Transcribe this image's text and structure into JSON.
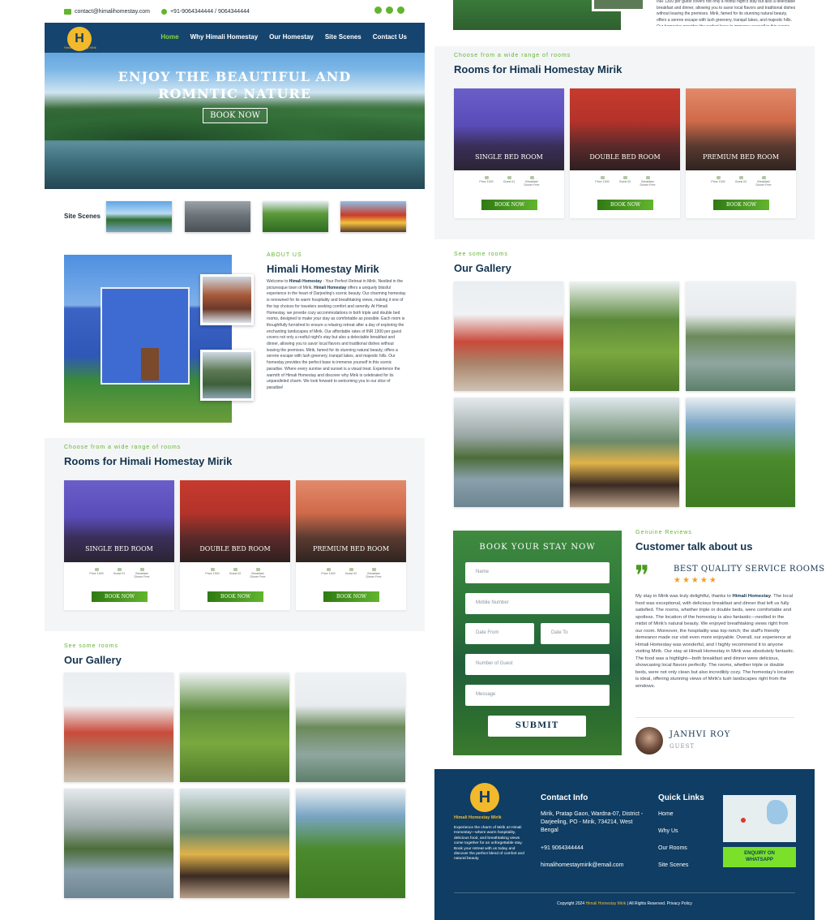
{
  "topbar": {
    "email": "contact@himalihomestay.com",
    "phone": "+91-9064344444 / 9064344444",
    "social_icons": [
      "whatsapp-icon",
      "instagram-icon",
      "facebook-icon"
    ]
  },
  "brand": {
    "logo_letter": "H",
    "name": "Himali Homestay Mirik"
  },
  "nav": {
    "items": [
      "Home",
      "Why Himali Homestay",
      "Our Homestay",
      "Site Scenes",
      "Contact Us"
    ],
    "active": "Home"
  },
  "hero": {
    "title_line1": "ENJOY THE BEAUTIFUL AND",
    "title_line2": "ROMNTIC NATURE",
    "button": "BOOK NOW"
  },
  "scenes": {
    "label": "Site Scenes"
  },
  "about": {
    "eyebrow": "ABOUT US",
    "title": "Himali Homestay Mirik",
    "intro": "Welcome to",
    "brand_bold": "Himali Homestay",
    "text_1": " - Your Perfect Retreat in Mirik. Nestled in the picturesque town of Mirik,",
    "brand_bold_2": "Himali Homestay",
    "text_2": " offers a uniquely blissful experience in the heart of Darjeeling's scenic beauty. Our charming homestay is renowned for its warm hospitality and breathtaking views, making it one of the top choices for travelers seeking comfort and serenity. At Himali Homestay, we provide cozy accommodations in both triple and double bed rooms, designed to make your stay as comfortable as possible. Each room is thoughtfully furnished to ensure a relaxing retreat after a day of exploring the enchanting landscapes of Mirik. Our affordable rates of INR 1300 per guest covers not only a restful night's stay but also a delectable breakfast and dinner, allowing you to savor local flavors and traditional dishes without leaving the premises. Mirik, famed for its stunning natural beauty, offers a serene escape with lush greenery, tranquil lakes, and majestic hills. Our homestay provides the perfect base to immerse yourself in this scenic paradise. Where every sunrise and sunset is a visual treat. Experience the warmth of Himali Homestay and discover why Mirik is celebrated for its unparalleled charm. We look forward to welcoming you to our slice of paradise!"
  },
  "rooms": {
    "eyebrow": "Choose from a wide range of rooms",
    "title": "Rooms for Himali Homestay Mirik",
    "items": [
      {
        "name": "SINGLE BED ROOM",
        "features": [
          "Price 1300",
          "Guest 01",
          "Breakfast Dinner Free"
        ],
        "button": "BOOK NOW"
      },
      {
        "name": "DOUBLE BED ROOM",
        "features": [
          "Price 1300",
          "Guest 02",
          "Breakfast Dinner Free"
        ],
        "button": "BOOK NOW"
      },
      {
        "name": "PREMIUM BED ROOM",
        "features": [
          "Price 1300",
          "Guest 02",
          "Breakfast Dinner Free"
        ],
        "button": "BOOK NOW"
      }
    ]
  },
  "gallery": {
    "eyebrow": "See some rooms",
    "title": "Our Gallery"
  },
  "booking": {
    "title": "BOOK YOUR STAY NOW",
    "name_placeholder": "Name",
    "mobile_placeholder": "Mobile Number",
    "date_from_placeholder": "Date From",
    "date_to_placeholder": "Date To",
    "guests_placeholder": "Number of Guest",
    "message_placeholder": "Message",
    "submit": "SUBMIT"
  },
  "reviews": {
    "eyebrow": "Genuine Reviews",
    "title": "Customer talk about us",
    "review_title": "BEST QUALITY SERVICE ROOMS",
    "stars": "★★★★★",
    "text_1": "My stay in Mirik was truly delightful, thanks to ",
    "brand_bold": "Himali Homestay",
    "text_2": ". The local food was exceptional, with delicious breakfast and dinner that left us fully satisfied. The rooms, whether triple or double beds, were comfortable and spotless. The location of the homestay is also fantastic—nestled in the midst of Mirik's natural beauty. We enjoyed breathtaking views right from our room. Moreover, the hospitality was top-notch; the staff's friendly demeanor made our visit even more enjoyable. Overall, our experience at Himali Homestay was wonderful, and I highly recommend it to anyone visiting Mirik. Our stay at Himali Homestay in Mirik was absolutely fantastic. The food was a highlight—both breakfast and dinner were delicious, showcasing local flavors perfectly. The rooms, whether triple or double beds, were not only clean but also incredibly cozy. The homestay's location is ideal, offering stunning views of Mirik's lush landscapes right from the windows.",
    "reviewer_name": "JANHVI ROY",
    "reviewer_role": "GUEST"
  },
  "footer": {
    "brand": "Himali Homestay Mirik",
    "description": "Experience the charm of Mirik at Himali Homestay—where warm hospitality, delicious food, and breathtaking views come together for an unforgettable stay. Book your retreat with us today and discover the perfect blend of comfort and natural beauty.",
    "contact_title": "Contact Info",
    "address": "Mirik, Pratap Gaon, Wardna-07, District - Darjeeling, PO - Mirik, 734214, West Bengal",
    "phone": "+91 9064344444",
    "email": "himalihomestaymirik@email.com",
    "links_title": "Quick Links",
    "links": [
      "Home",
      "Why Us",
      "Our Rooms",
      "Site Scenes"
    ],
    "whatsapp_line1": "ENQUIRY ON",
    "whatsapp_line2": "WHATSAPP",
    "copyright_pre": "Copyright 2024 ",
    "copyright_brand": "Himali Homestay Mirik",
    "copyright_post": " | All Rights Reserved. Privacy Policy"
  },
  "colors": {
    "navy": "#0f3d63",
    "green": "#62b52e",
    "gold": "#f2b92c",
    "whatsapp": "#7be02a"
  }
}
